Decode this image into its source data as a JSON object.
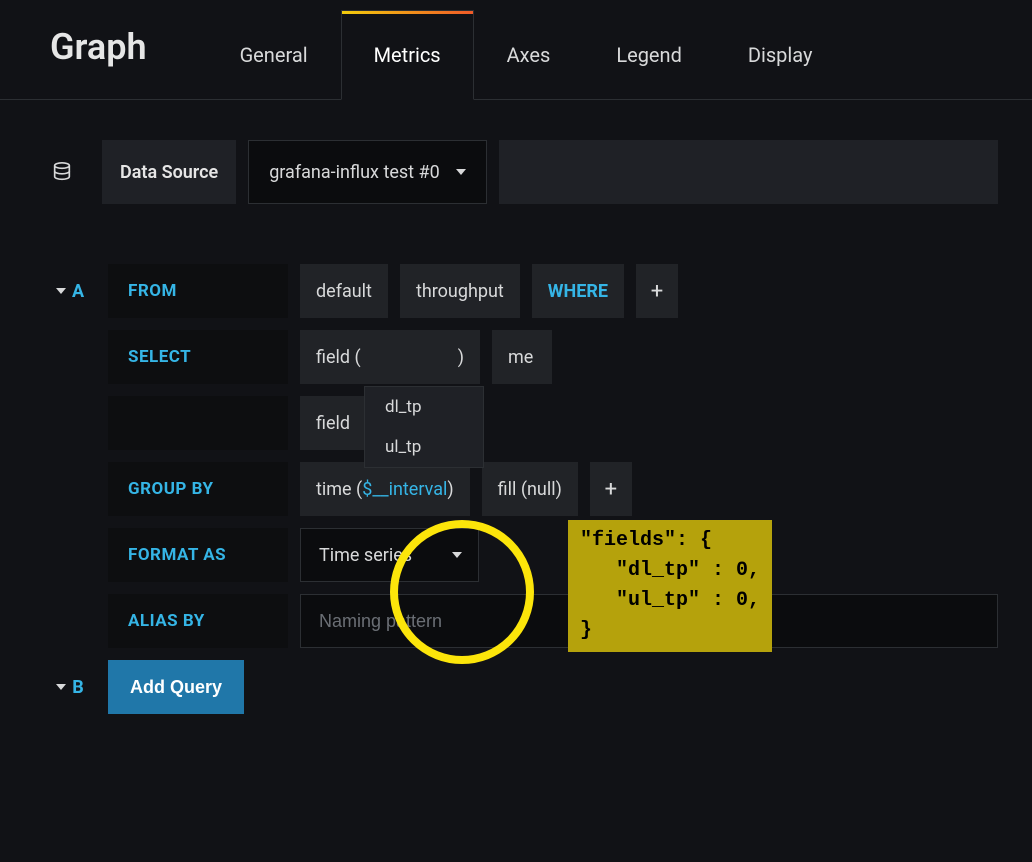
{
  "title": "Graph",
  "tabs": [
    "General",
    "Metrics",
    "Axes",
    "Legend",
    "Display"
  ],
  "active_tab": 1,
  "datasource": {
    "label": "Data Source",
    "selected": "grafana-influx test #0"
  },
  "query_a": {
    "id": "A",
    "from": {
      "label": "FROM",
      "policy": "default",
      "measurement": "throughput",
      "where_kw": "WHERE"
    },
    "select": {
      "label": "SELECT",
      "row1": {
        "field_left": "field (",
        "field_right": ")",
        "agg_partial": "me"
      },
      "row2": {
        "field_left": "field"
      },
      "options": [
        "dl_tp",
        "ul_tp"
      ]
    },
    "group_by": {
      "label": "GROUP BY",
      "time_left": "time (",
      "time_arg": "$__interval",
      "time_right": ")",
      "fill": "fill (null)"
    },
    "format": {
      "label": "FORMAT AS",
      "value": "Time series"
    },
    "alias": {
      "label": "ALIAS BY",
      "placeholder": "Naming pattern",
      "value": ""
    }
  },
  "query_b": {
    "id": "B",
    "add_label": "Add Query"
  },
  "tooltip": {
    "text": "\"fields\": {\n   \"dl_tp\" : 0,\n   \"ul_tp\" : 0,\n}"
  },
  "icons": {
    "plus": "+"
  }
}
